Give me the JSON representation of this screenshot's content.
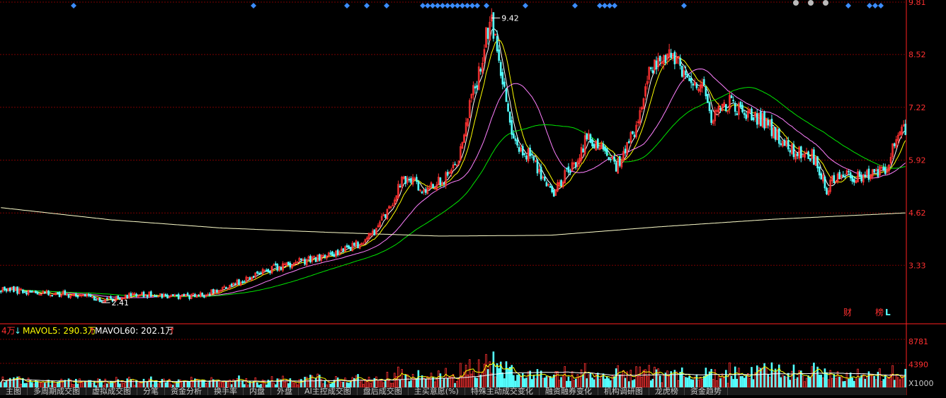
{
  "colors": {
    "up": "#ff3232",
    "down": "#54ffff",
    "ma5": "#ffffff",
    "ma10": "#ffff00",
    "ma20": "#ff80ff",
    "ma60": "#00e600",
    "ma250": "#ffffcc",
    "grid": "#7a0000",
    "axis": "#ff2020",
    "marker": "#3b8cff"
  },
  "volume_header": {
    "prefix": "4万",
    "prefix_arrow": "↓",
    "mavol5": "MAVOL5: 290.3万",
    "mavol5_arrow": "↑",
    "mavol60": "MAVOL60: 202.1万",
    "mavol60_arrow": "↑"
  },
  "badges": {
    "cai": "财",
    "bang": "榜",
    "l": "L"
  },
  "chart_data": {
    "type": "candlestick",
    "y_ticks": [
      "9.81",
      "8.52",
      "7.22",
      "5.92",
      "4.62",
      "3.33"
    ],
    "y_tick_values": [
      9.81,
      8.52,
      7.22,
      5.92,
      4.62,
      3.33
    ],
    "ylim": [
      2.03,
      9.81
    ],
    "annotations": [
      {
        "text": "9.42",
        "value": 9.42
      },
      {
        "text": "2.41",
        "value": 2.41
      }
    ],
    "price_keypoints": [
      [
        0,
        2.75
      ],
      [
        20,
        2.66
      ],
      [
        35,
        2.62
      ],
      [
        50,
        2.55
      ],
      [
        55,
        2.45
      ],
      [
        65,
        2.55
      ],
      [
        82,
        2.62
      ],
      [
        95,
        2.57
      ],
      [
        108,
        2.58
      ],
      [
        120,
        2.72
      ],
      [
        135,
        3.02
      ],
      [
        145,
        3.2
      ],
      [
        160,
        3.4
      ],
      [
        172,
        3.48
      ],
      [
        182,
        3.62
      ],
      [
        190,
        3.72
      ],
      [
        197,
        3.92
      ],
      [
        205,
        4.22
      ],
      [
        212,
        4.72
      ],
      [
        218,
        5.35
      ],
      [
        224,
        5.45
      ],
      [
        230,
        5.12
      ],
      [
        237,
        5.3
      ],
      [
        244,
        5.5
      ],
      [
        250,
        6.05
      ],
      [
        256,
        7.2
      ],
      [
        261,
        8.1
      ],
      [
        265,
        8.95
      ],
      [
        268,
        9.25
      ],
      [
        272,
        8.4
      ],
      [
        278,
        6.7
      ],
      [
        284,
        6.1
      ],
      [
        290,
        6.0
      ],
      [
        298,
        5.28
      ],
      [
        302,
        5.15
      ],
      [
        308,
        5.55
      ],
      [
        314,
        5.9
      ],
      [
        320,
        6.45
      ],
      [
        326,
        6.3
      ],
      [
        331,
        6.1
      ],
      [
        336,
        5.8
      ],
      [
        341,
        6.1
      ],
      [
        348,
        6.9
      ],
      [
        354,
        8.0
      ],
      [
        360,
        8.35
      ],
      [
        366,
        8.45
      ],
      [
        372,
        8.2
      ],
      [
        378,
        7.9
      ],
      [
        384,
        7.6
      ],
      [
        388,
        7.0
      ],
      [
        393,
        7.2
      ],
      [
        398,
        7.35
      ],
      [
        405,
        7.05
      ],
      [
        412,
        7.0
      ],
      [
        418,
        6.85
      ],
      [
        424,
        6.55
      ],
      [
        430,
        6.2
      ],
      [
        437,
        6.1
      ],
      [
        443,
        6.05
      ],
      [
        448,
        5.6
      ],
      [
        451,
        5.2
      ],
      [
        455,
        5.45
      ],
      [
        460,
        5.6
      ],
      [
        466,
        5.48
      ],
      [
        473,
        5.52
      ],
      [
        480,
        5.62
      ],
      [
        484,
        5.75
      ],
      [
        487,
        6.3
      ],
      [
        490,
        6.6
      ],
      [
        494,
        6.65
      ]
    ],
    "ma250_keypoints": [
      [
        0,
        4.75
      ],
      [
        60,
        4.45
      ],
      [
        120,
        4.25
      ],
      [
        180,
        4.14
      ],
      [
        240,
        4.05
      ],
      [
        300,
        4.07
      ],
      [
        360,
        4.28
      ],
      [
        420,
        4.46
      ],
      [
        494,
        4.62
      ]
    ],
    "volume_y_ticks": [
      "8781",
      "4390",
      "X1000"
    ],
    "volume_y_tick_values": [
      8781,
      4390
    ],
    "volume_max": 10500,
    "top_markers_count": 38,
    "num_bars": 495
  },
  "tabs": [
    "主图",
    "多周期成交图",
    "虚拟成交图",
    "分笔",
    "资金分析",
    "换手率",
    "内盘",
    "外盘",
    "AI主控成交图",
    "盘后成交图",
    "主买意愿(%)",
    "特殊主动成交变化",
    "融资融券变化",
    "机构调研图",
    "龙虎榜",
    "资金趋势"
  ]
}
